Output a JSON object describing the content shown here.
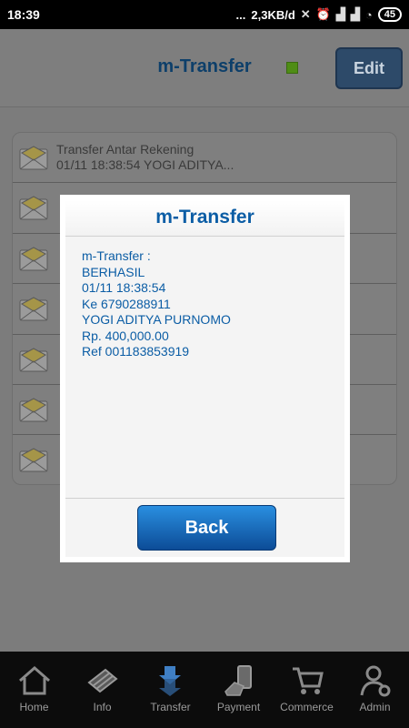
{
  "status_bar": {
    "time": "18:39",
    "dots": "...",
    "speed": "2,3KB/d",
    "battery": "45"
  },
  "header": {
    "title": "m-Transfer",
    "edit_label": "Edit"
  },
  "list": {
    "items": [
      {
        "line1": "Transfer Antar Rekening",
        "line2": "01/11 18:38:54 YOGI ADITYA..."
      },
      {
        "line1": "",
        "line2": ""
      },
      {
        "line1": "",
        "line2": ""
      },
      {
        "line1": "",
        "line2": ""
      },
      {
        "line1": "",
        "line2": ""
      },
      {
        "line1": "",
        "line2": ""
      },
      {
        "line1": "",
        "line2": ""
      }
    ]
  },
  "dialog": {
    "title": "m-Transfer",
    "lines": [
      "m-Transfer :",
      "BERHASIL",
      "01/11 18:38:54",
      "Ke 6790288911",
      "YOGI ADITYA PURNOMO",
      "Rp. 400,000.00",
      "Ref 001183853919"
    ],
    "back_label": "Back"
  },
  "bottom_nav": {
    "items": [
      {
        "label": "Home",
        "icon": "home-icon"
      },
      {
        "label": "Info",
        "icon": "info-icon"
      },
      {
        "label": "Transfer",
        "icon": "transfer-icon"
      },
      {
        "label": "Payment",
        "icon": "payment-icon"
      },
      {
        "label": "Commerce",
        "icon": "cart-icon"
      },
      {
        "label": "Admin",
        "icon": "admin-icon"
      }
    ]
  },
  "colors": {
    "accent": "#0b5da5",
    "button_top": "#2a8fe0",
    "button_bottom": "#0c4c97",
    "overlay": "#7c7c7c"
  }
}
